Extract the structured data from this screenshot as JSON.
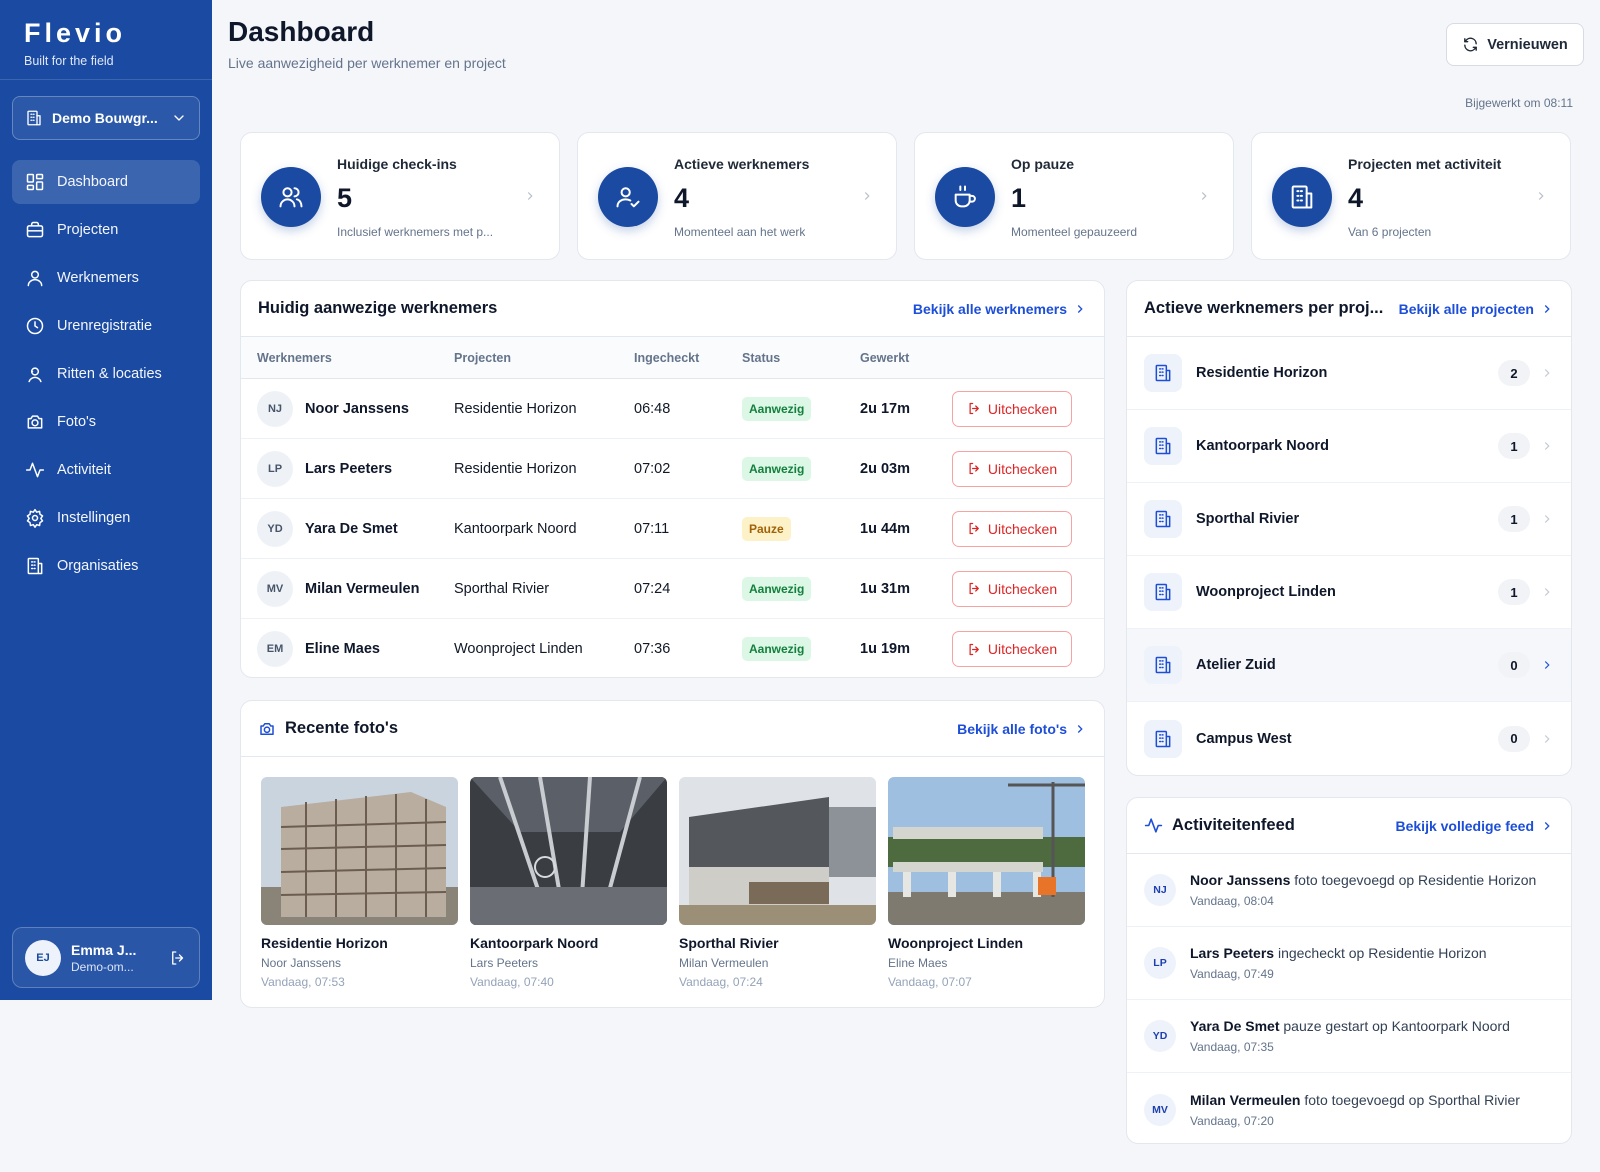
{
  "brand": {
    "name": "Flevio",
    "tagline": "Built for the field"
  },
  "org": {
    "selected": "Demo Bouwgr..."
  },
  "nav": [
    {
      "label": "Dashboard",
      "icon": "grid-icon",
      "active": true
    },
    {
      "label": "Projecten",
      "icon": "briefcase-icon"
    },
    {
      "label": "Werknemers",
      "icon": "user-icon"
    },
    {
      "label": "Urenregistratie",
      "icon": "clock-icon"
    },
    {
      "label": "Ritten & locaties",
      "icon": "map-pin-user-icon"
    },
    {
      "label": "Foto's",
      "icon": "camera-icon"
    },
    {
      "label": "Activiteit",
      "icon": "activity-icon"
    },
    {
      "label": "Instellingen",
      "icon": "gear-icon"
    },
    {
      "label": "Organisaties",
      "icon": "building-icon"
    }
  ],
  "user": {
    "initials": "EJ",
    "name": "Emma J...",
    "role": "Demo-om..."
  },
  "header": {
    "title": "Dashboard",
    "subtitle": "Live aanwezigheid per werknemer en project",
    "refresh_label": "Vernieuwen",
    "updated": "Bijgewerkt om 08:11"
  },
  "stats": [
    {
      "label": "Huidige check-ins",
      "value": "5",
      "desc": "Inclusief werknemers met p...",
      "icon": "users-icon"
    },
    {
      "label": "Actieve werknemers",
      "value": "4",
      "desc": "Momenteel aan het werk",
      "icon": "user-check-icon"
    },
    {
      "label": "Op pauze",
      "value": "1",
      "desc": "Momenteel gepauzeerd",
      "icon": "coffee-icon"
    },
    {
      "label": "Projecten met activiteit",
      "value": "4",
      "desc": "Van 6 projecten",
      "icon": "building-icon"
    }
  ],
  "employees": {
    "title": "Huidig aanwezige werknemers",
    "link": "Bekijk alle werknemers",
    "columns": [
      "Werknemers",
      "Projecten",
      "Ingecheckt",
      "Status",
      "Gewerkt"
    ],
    "checkout_label": "Uitchecken",
    "rows": [
      {
        "initials": "NJ",
        "name": "Noor Janssens",
        "project": "Residentie Horizon",
        "checkin": "06:48",
        "status": "Aanwezig",
        "status_color": "#15803d",
        "worked": "2u 17m"
      },
      {
        "initials": "LP",
        "name": "Lars Peeters",
        "project": "Residentie Horizon",
        "checkin": "07:02",
        "status": "Aanwezig",
        "status_color": "#15803d",
        "worked": "2u 03m"
      },
      {
        "initials": "YD",
        "name": "Yara De Smet",
        "project": "Kantoorpark Noord",
        "checkin": "07:11",
        "status": "Pauze",
        "status_color": "#a16207",
        "worked": "1u 44m"
      },
      {
        "initials": "MV",
        "name": "Milan Vermeulen",
        "project": "Sporthal Rivier",
        "checkin": "07:24",
        "status": "Aanwezig",
        "status_color": "#15803d",
        "worked": "1u 31m"
      },
      {
        "initials": "EM",
        "name": "Eline Maes",
        "project": "Woonproject Linden",
        "checkin": "07:36",
        "status": "Aanwezig",
        "status_color": "#15803d",
        "worked": "1u 19m"
      }
    ]
  },
  "photos": {
    "title": "Recente foto's",
    "link": "Bekijk alle foto's",
    "items": [
      {
        "project": "Residentie Horizon",
        "worker": "Noor Janssens",
        "date": "Vandaag, 07:53"
      },
      {
        "project": "Kantoorpark Noord",
        "worker": "Lars Peeters",
        "date": "Vandaag, 07:40"
      },
      {
        "project": "Sporthal Rivier",
        "worker": "Milan Vermeulen",
        "date": "Vandaag, 07:24"
      },
      {
        "project": "Woonproject Linden",
        "worker": "Eline Maes",
        "date": "Vandaag, 07:07"
      }
    ]
  },
  "projects": {
    "title": "Actieve werknemers per proj...",
    "link": "Bekijk alle projecten",
    "items": [
      {
        "name": "Residentie Horizon",
        "count": "2"
      },
      {
        "name": "Kantoorpark Noord",
        "count": "1"
      },
      {
        "name": "Sporthal Rivier",
        "count": "1"
      },
      {
        "name": "Woonproject Linden",
        "count": "1"
      },
      {
        "name": "Atelier Zuid",
        "count": "0"
      },
      {
        "name": "Campus West",
        "count": "0"
      }
    ]
  },
  "activity": {
    "title": "Activiteitenfeed",
    "link": "Bekijk volledige feed",
    "items": [
      {
        "initials": "NJ",
        "name": "Noor Janssens",
        "text": "foto toegevoegd op Residentie Horizon",
        "time": "Vandaag, 08:04"
      },
      {
        "initials": "LP",
        "name": "Lars Peeters",
        "text": "ingecheckt op Residentie Horizon",
        "time": "Vandaag, 07:49"
      },
      {
        "initials": "YD",
        "name": "Yara De Smet",
        "text": "pauze gestart op Kantoorpark Noord",
        "time": "Vandaag, 07:35"
      },
      {
        "initials": "MV",
        "name": "Milan Vermeulen",
        "text": "foto toegevoegd op Sporthal Rivier",
        "time": "Vandaag, 07:20"
      }
    ]
  },
  "colors": {
    "sidebar": "#1a4aa1",
    "accent": "#1d4ed8",
    "danger": "#dc2626",
    "present": "#15803d",
    "pause": "#a16207"
  }
}
